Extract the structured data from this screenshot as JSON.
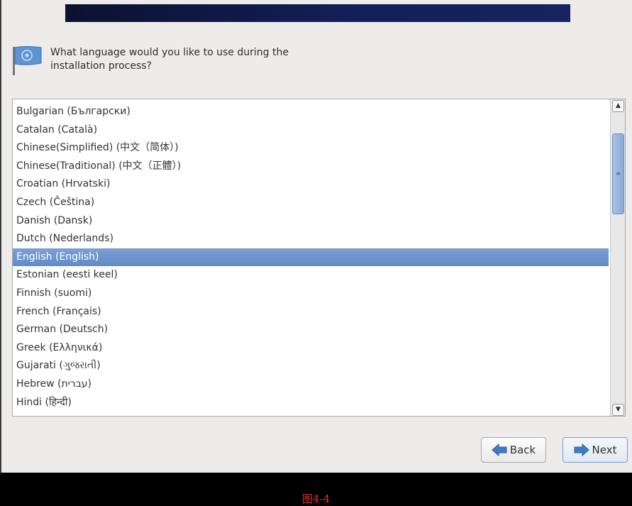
{
  "question": "What language would you like to use during the installation process?",
  "question_lines": [
    "What language would you like to use during the",
    "installation process?"
  ],
  "languages": [
    "Bulgarian (Български)",
    "Catalan (Català)",
    "Chinese(Simplified) (中文（简体）)",
    "Chinese(Traditional) (中文（正體）)",
    "Croatian (Hrvatski)",
    "Czech (Čeština)",
    "Danish (Dansk)",
    "Dutch (Nederlands)",
    "English (English)",
    "Estonian (eesti keel)",
    "Finnish (suomi)",
    "French (Français)",
    "German (Deutsch)",
    "Greek (Ελληνικά)",
    "Gujarati (ગુજરાતી)",
    "Hebrew (עברית)",
    "Hindi (हिन्दी)"
  ],
  "selected": "English (English)",
  "buttons": {
    "back": "Back",
    "next": "Next"
  },
  "caption": "图4-4",
  "colors": {
    "selection": "#6f95cd",
    "banner": "#10194a",
    "caption": "#e0312b"
  }
}
